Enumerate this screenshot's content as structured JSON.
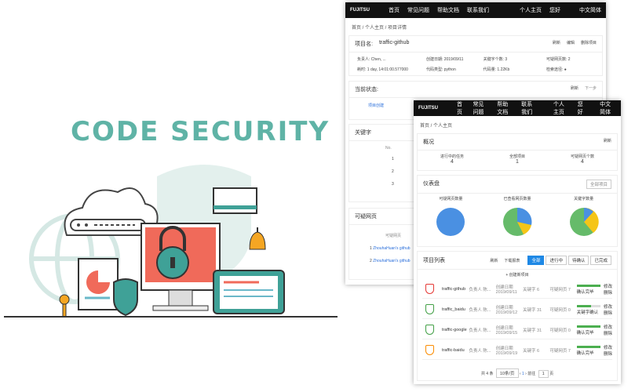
{
  "brand": {
    "text": "CODE SECURITY"
  },
  "back": {
    "nav": {
      "logo": "FUJITSU",
      "items": [
        "首页",
        "常见问题",
        "帮助文档",
        "联系我们"
      ],
      "user": "个人主页",
      "greet": "您好",
      "lang": "中文简体"
    },
    "crumb": "首页 / 个人主页 / 项目详情",
    "project": {
      "name_label": "项目名:",
      "name": "traffic-github",
      "actions": [
        "刷新",
        "编辑",
        "删除项目"
      ],
      "fields": [
        {
          "k": "负责人:",
          "v": "Chen, ..."
        },
        {
          "k": "创建日期:",
          "v": "2019/09/11"
        },
        {
          "k": "关键字个数:",
          "v": "3"
        },
        {
          "k": "可疑网页数:",
          "v": "2"
        },
        {
          "k": "耗时:",
          "v": "1 day, 14:01:00.577000"
        },
        {
          "k": "代码类型:",
          "v": "python"
        },
        {
          "k": "代码量:",
          "v": "1.22Kb"
        },
        {
          "k": "检索途径:",
          "v": ""
        }
      ]
    },
    "status": {
      "title": "当前状态:",
      "refresh": "刷新",
      "next": "下一步",
      "step": "项目创建"
    },
    "keywords": {
      "title": "关键字",
      "col": "No.",
      "rows": [
        "1",
        "2",
        "3"
      ]
    },
    "pages": {
      "title": "可疑网页",
      "col": "可疑网页",
      "rows": [
        {
          "no": "1",
          "url": "ZhouhaHuan's github"
        },
        {
          "no": "2",
          "url": "ZhouhaHuan's github"
        }
      ]
    }
  },
  "front": {
    "nav": {
      "logo": "FUJITSU",
      "items": [
        "首页",
        "常见问题",
        "帮助文档",
        "联系我们"
      ],
      "user": "个人主页",
      "greet": "您好",
      "lang": "中文简体"
    },
    "crumb": "首页 / 个人主页",
    "overview": {
      "title": "概况",
      "refresh": "刷新",
      "stats": [
        {
          "label": "进行中的任务",
          "value": "4"
        },
        {
          "label": "全部项目",
          "value": "1"
        },
        {
          "label": "可疑网页个数",
          "value": "4"
        }
      ]
    },
    "dashboard": {
      "title": "仪表盘",
      "filter": "全部项目",
      "charts": [
        {
          "label": "可疑网页数量"
        },
        {
          "label": "已查看网页数量"
        },
        {
          "label": "关键字数量"
        }
      ]
    },
    "list": {
      "title": "项目列表",
      "refresh": "刷新",
      "download": "下载报表",
      "filters": [
        "全部",
        "进行中",
        "待确认",
        "已完成"
      ],
      "create": "创建新项目",
      "rows": [
        {
          "name": "traffic-github",
          "owner": "负责人 陈...",
          "date": "创建日期 2019/09/11",
          "kw": "关键字 6",
          "pages": "可疑网页 7",
          "status": "确认完毕",
          "color": "#e53935"
        },
        {
          "name": "traffic_baidu",
          "owner": "负责人 陈...",
          "date": "创建日期 2019/09/12",
          "kw": "关键字 31",
          "pages": "可疑网页 0",
          "status": "关键字确认",
          "color": "#43a047"
        },
        {
          "name": "traffic-google",
          "owner": "负责人 陈...",
          "date": "创建日期 2019/09/15",
          "kw": "关键字 31",
          "pages": "可疑网页 0",
          "status": "确认完毕",
          "color": "#43a047"
        },
        {
          "name": "traffic-baidu",
          "owner": "负责人 陈...",
          "date": "创建日期 2019/09/19",
          "kw": "关键字 6",
          "pages": "可疑网页 7",
          "status": "确认完毕",
          "color": "#fb8c00"
        }
      ],
      "edit": "修改",
      "del": "删除",
      "pager": {
        "total": "共 4 条",
        "size": "10条/页",
        "page": "1",
        "goto": "前往",
        "goto_val": "1",
        "unit": "页"
      }
    }
  }
}
